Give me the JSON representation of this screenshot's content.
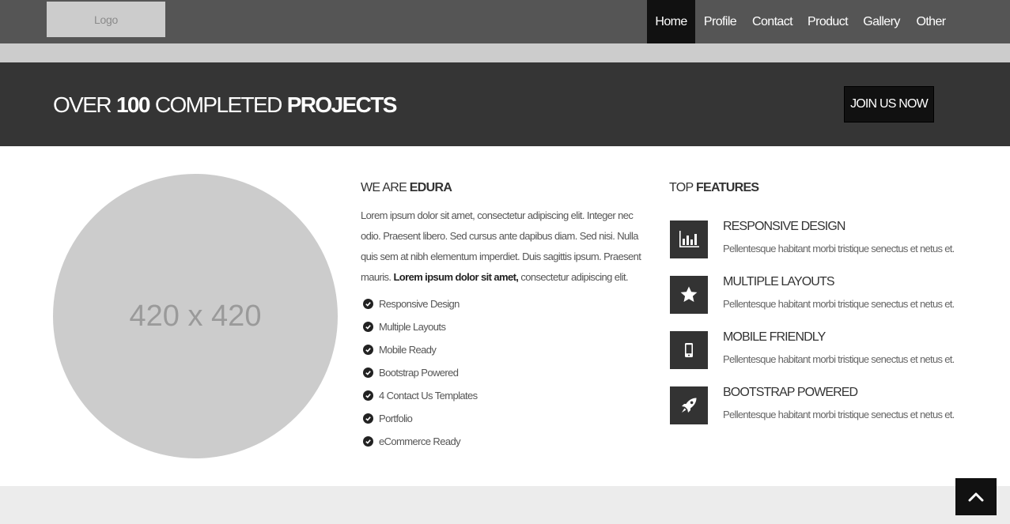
{
  "header": {
    "logo_text": "Logo",
    "nav": [
      {
        "label": "Home",
        "active": true
      },
      {
        "label": "Profile"
      },
      {
        "label": "Contact"
      },
      {
        "label": "Product"
      },
      {
        "label": "Gallery"
      },
      {
        "label": "Other"
      }
    ]
  },
  "banner": {
    "title_pre": "OVER",
    "title_num": "100",
    "title_mid": "COMPLETED",
    "title_bold": "PROJECTS",
    "cta_label": "JOIN US NOW"
  },
  "image_placeholder": {
    "label": "420 x 420"
  },
  "about": {
    "heading_pre": "WE ARE",
    "heading_bold": "EDURA",
    "paragraph_text": "Lorem ipsum dolor sit amet, consectetur adipiscing elit. Integer nec odio. Praesent libero. Sed cursus ante dapibus diam. Sed nisi. Nulla quis sem at nibh elementum imperdiet. Duis sagittis ipsum. Praesent mauris.",
    "paragraph_bold": "Lorem ipsum dolor sit amet,",
    "paragraph_tail": "consectetur adipiscing elit.",
    "checklist": [
      "Responsive Design",
      "Multiple Layouts",
      "Mobile Ready",
      "Bootstrap Powered",
      "4 Contact Us Templates",
      "Portfolio",
      "eCommerce Ready"
    ]
  },
  "features": {
    "heading_pre": "TOP",
    "heading_bold": "FEATURES",
    "items": [
      {
        "icon": "bar-chart-icon",
        "title": "RESPONSIVE DESIGN",
        "desc": "Pellentesque habitant morbi tristique senectus et netus et."
      },
      {
        "icon": "star-icon",
        "title": "MULTIPLE LAYOUTS",
        "desc": "Pellentesque habitant morbi tristique senectus et netus et."
      },
      {
        "icon": "mobile-icon",
        "title": "MOBILE FRIENDLY",
        "desc": "Pellentesque habitant morbi tristique senectus et netus et."
      },
      {
        "icon": "rocket-icon",
        "title": "BOOTSTRAP POWERED",
        "desc": "Pellentesque habitant morbi tristique senectus et netus et."
      }
    ]
  },
  "scroll_top": {
    "icon": "chevron-up-icon"
  },
  "colors": {
    "header_bg": "#555555",
    "nav_active_bg": "#111111",
    "banner_bg": "#353535",
    "placeholder_gray": "#cccccc",
    "feature_box_bg": "#333333",
    "footer_bg": "#ececec"
  }
}
